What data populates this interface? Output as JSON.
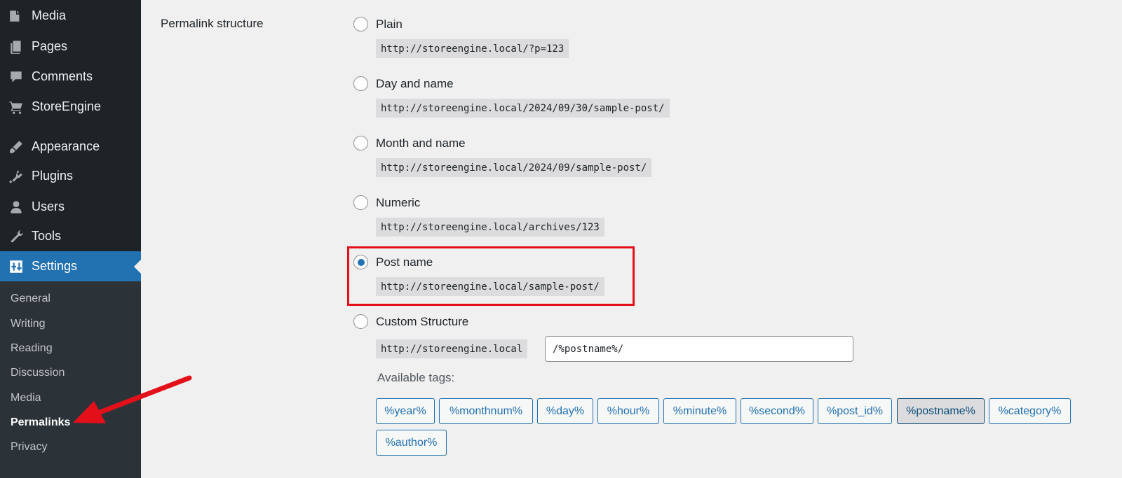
{
  "sidebar": {
    "items": [
      {
        "label": "Media",
        "icon": "media-icon"
      },
      {
        "label": "Pages",
        "icon": "pages-icon"
      },
      {
        "label": "Comments",
        "icon": "comments-icon"
      },
      {
        "label": "StoreEngine",
        "icon": "cart-icon"
      },
      {
        "label": "Appearance",
        "icon": "appearance-icon"
      },
      {
        "label": "Plugins",
        "icon": "plugins-icon"
      },
      {
        "label": "Users",
        "icon": "users-icon"
      },
      {
        "label": "Tools",
        "icon": "tools-icon"
      },
      {
        "label": "Settings",
        "icon": "settings-icon",
        "active": true
      }
    ],
    "submenu": [
      "General",
      "Writing",
      "Reading",
      "Discussion",
      "Media",
      "Permalinks",
      "Privacy"
    ],
    "current_submenu": "Permalinks"
  },
  "permalinks": {
    "row_label": "Permalink structure",
    "options": [
      {
        "label": "Plain",
        "example": "http://storeengine.local/?p=123",
        "checked": false
      },
      {
        "label": "Day and name",
        "example": "http://storeengine.local/2024/09/30/sample-post/",
        "checked": false
      },
      {
        "label": "Month and name",
        "example": "http://storeengine.local/2024/09/sample-post/",
        "checked": false
      },
      {
        "label": "Numeric",
        "example": "http://storeengine.local/archives/123",
        "checked": false
      },
      {
        "label": "Post name",
        "example": "http://storeengine.local/sample-post/",
        "checked": true
      },
      {
        "label": "Custom Structure",
        "example": "http://storeengine.local",
        "checked": false
      }
    ],
    "custom_value": "/%postname%/",
    "available_tags_label": "Available tags:",
    "tags": [
      "%year%",
      "%monthnum%",
      "%day%",
      "%hour%",
      "%minute%",
      "%second%",
      "%post_id%",
      "%postname%",
      "%category%",
      "%author%"
    ],
    "active_tag": "%postname%"
  },
  "colors": {
    "sidebar_bg": "#1d2327",
    "accent": "#2271b1",
    "highlight": "#e3101a"
  }
}
